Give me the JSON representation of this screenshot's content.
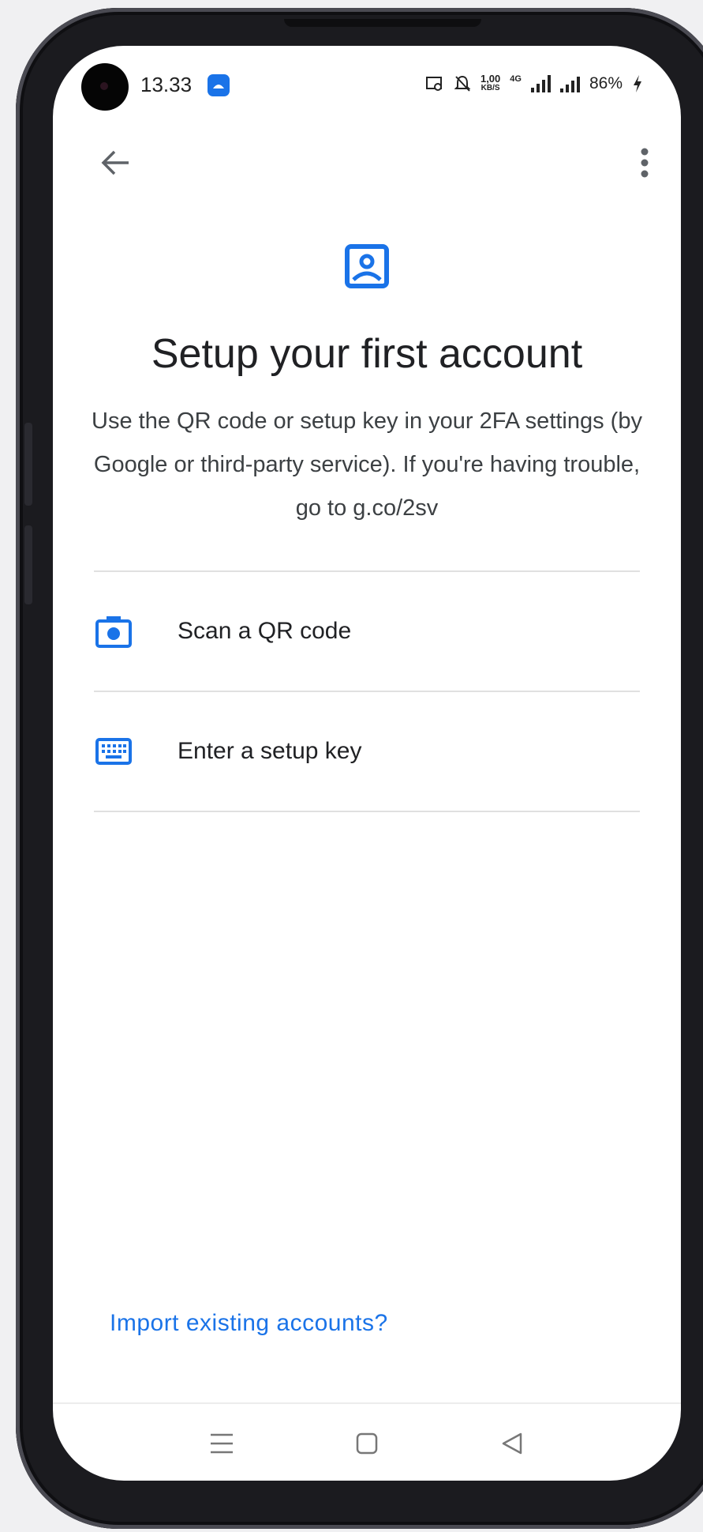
{
  "status_bar": {
    "time": "13.33",
    "net_speed_value": "1,00",
    "net_speed_unit": "KB/S",
    "network_type": "4G",
    "battery_percent": "86%"
  },
  "header": {
    "back_icon": "arrow-back-icon",
    "more_icon": "more-vert-icon"
  },
  "hero": {
    "icon": "account-box-icon",
    "title": "Setup your first account",
    "description": "Use the QR code or setup key in your 2FA settings (by Google or third-party service). If you're having trouble, go to g.co/2sv"
  },
  "options": [
    {
      "icon": "camera-icon",
      "label": "Scan a QR code"
    },
    {
      "icon": "keyboard-icon",
      "label": "Enter a setup key"
    }
  ],
  "footer": {
    "import_link": "Import existing accounts?"
  },
  "nav": {
    "menu_icon": "recents-icon",
    "home_icon": "home-icon",
    "back_icon": "nav-back-icon"
  },
  "colors": {
    "accent": "#1a73e8",
    "text_primary": "#202124",
    "divider": "#e0e0e0"
  }
}
